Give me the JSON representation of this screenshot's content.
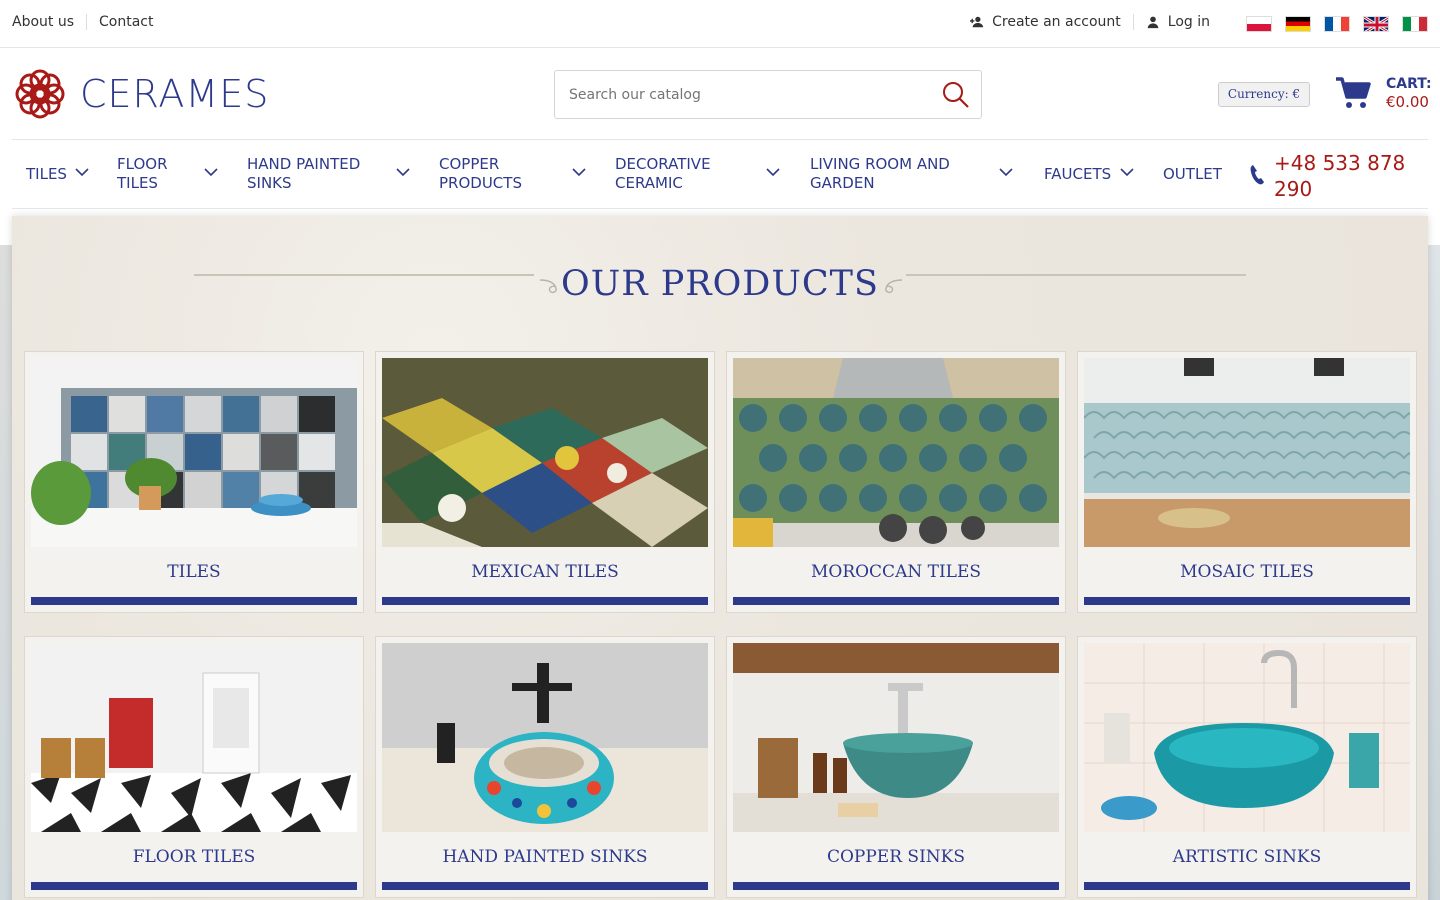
{
  "topbar": {
    "about": "About us",
    "contact": "Contact",
    "create_account": "Create an account",
    "login": "Log in",
    "flags": [
      "pl-flag-icon",
      "de-flag-icon",
      "fr-flag-icon",
      "uk-flag-icon",
      "it-flag-icon"
    ]
  },
  "brand": {
    "name": "CERAMES",
    "color": "#2d3a8c",
    "accent": "#a71a17"
  },
  "search": {
    "placeholder": "Search our catalog"
  },
  "currency": {
    "label": "Currency: €"
  },
  "cart": {
    "label": "CART:",
    "amount": "€0.00"
  },
  "nav": {
    "items": [
      {
        "label": "TILES"
      },
      {
        "label": "FLOOR TILES"
      },
      {
        "label": "HAND PAINTED SINKS"
      },
      {
        "label": "COPPER PRODUCTS"
      },
      {
        "label": "DECORATIVE CERAMIC"
      },
      {
        "label": "LIVING ROOM AND GARDEN"
      },
      {
        "label": "FAUCETS"
      },
      {
        "label": "OUTLET"
      }
    ],
    "phone": "+48 533 878 290"
  },
  "products": {
    "heading": "OUR PRODUCTS",
    "cards": [
      {
        "label": "TILES"
      },
      {
        "label": "MEXICAN TILES"
      },
      {
        "label": "MOROCCAN TILES"
      },
      {
        "label": "MOSAIC TILES"
      },
      {
        "label": "FLOOR TILES"
      },
      {
        "label": "HAND PAINTED SINKS"
      },
      {
        "label": "COPPER SINKS"
      },
      {
        "label": "ARTISTIC SINKS"
      }
    ]
  }
}
